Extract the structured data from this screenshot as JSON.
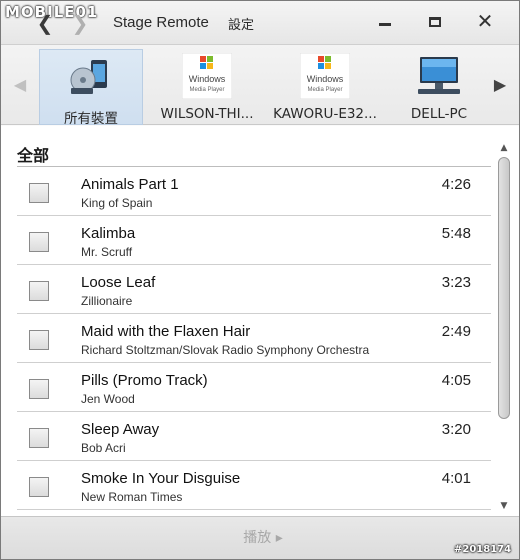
{
  "watermark": "MOBILE01",
  "titlebar": {
    "app_title": "Stage Remote",
    "settings_label": "設定",
    "back_icon": "chevron-left-icon",
    "forward_icon": "chevron-right-icon"
  },
  "devices": [
    {
      "label": "所有裝置",
      "icon": "devices-icon",
      "selected": true
    },
    {
      "label": "WILSON-THI...",
      "icon": "windows-media-player-icon",
      "selected": false
    },
    {
      "label": "KAWORU-E32...",
      "icon": "windows-media-player-icon",
      "selected": false
    },
    {
      "label": "DELL-PC",
      "icon": "computer-icon",
      "selected": false
    }
  ],
  "wmp_logo_text": [
    "Windows",
    "Media Player"
  ],
  "list": {
    "header": "全部",
    "tracks": [
      {
        "title": "Animals Part 1",
        "artist": "King of Spain",
        "duration": "4:26"
      },
      {
        "title": "Kalimba",
        "artist": "Mr. Scruff",
        "duration": "5:48"
      },
      {
        "title": "Loose Leaf",
        "artist": "Zillionaire",
        "duration": "3:23"
      },
      {
        "title": "Maid with the Flaxen Hair",
        "artist": "Richard Stoltzman/Slovak Radio Symphony Orchestra",
        "duration": "2:49"
      },
      {
        "title": "Pills (Promo Track)",
        "artist": "Jen Wood",
        "duration": "4:05"
      },
      {
        "title": "Sleep Away",
        "artist": "Bob Acri",
        "duration": "3:20"
      },
      {
        "title": "Smoke In Your Disguise",
        "artist": "New Roman Times",
        "duration": "4:01"
      }
    ]
  },
  "footer": {
    "play_label": "播放 ▸"
  },
  "stamp": "#2018174",
  "colors": {
    "selected_device_bg": "#cfdff0",
    "windows_red": "#e8492b",
    "windows_green": "#7cbb2d",
    "windows_blue": "#1d8fe0",
    "windows_yellow": "#f7b719"
  }
}
